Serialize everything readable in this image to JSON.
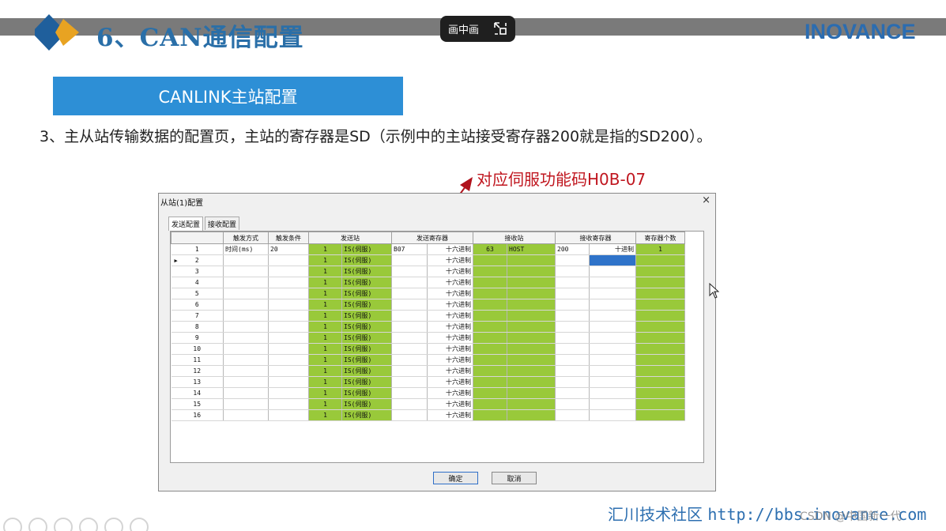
{
  "slide": {
    "title": "6、CAN通信配置",
    "brand": "INOVANCE",
    "pip_label": "画中画",
    "section_label": "CANLINK主站配置",
    "description": "3、主从站传输数据的配置页，主站的寄存器是SD（示例中的主站接受寄存器200就是指的SD200）。",
    "annotation": "对应伺服功能码H0B-07",
    "footer_cn": "汇川技术社区",
    "footer_url": "http://bbs.inovance.com",
    "watermark": "CSDN @中国新一代"
  },
  "dialog": {
    "title": "从站(1)配置",
    "close_glyph": "×",
    "tabs": [
      "发送配置",
      "接收配置"
    ],
    "columns": [
      "触发方式",
      "触发条件",
      "发送站",
      "发送寄存器",
      "接收站",
      "接收寄存器",
      "寄存器个数"
    ],
    "rows": [
      {
        "no": "1",
        "trigger": "时间(ms)",
        "cond": "20",
        "send_id": "1",
        "send_type": "IS(伺服)",
        "send_reg": "B07",
        "send_fmt": "十六进制",
        "recv_id": "63",
        "recv_type": "HOST",
        "recv_reg": "200",
        "recv_fmt": "十进制",
        "count": "1"
      },
      {
        "no": "2",
        "trigger": "",
        "cond": "",
        "send_id": "1",
        "send_type": "IS(伺服)",
        "send_reg": "",
        "send_fmt": "十六进制",
        "recv_id": "",
        "recv_type": "",
        "recv_reg": "",
        "recv_fmt": "",
        "count": ""
      },
      {
        "no": "3",
        "trigger": "",
        "cond": "",
        "send_id": "1",
        "send_type": "IS(伺服)",
        "send_reg": "",
        "send_fmt": "十六进制",
        "recv_id": "",
        "recv_type": "",
        "recv_reg": "",
        "recv_fmt": "",
        "count": ""
      },
      {
        "no": "4",
        "trigger": "",
        "cond": "",
        "send_id": "1",
        "send_type": "IS(伺服)",
        "send_reg": "",
        "send_fmt": "十六进制",
        "recv_id": "",
        "recv_type": "",
        "recv_reg": "",
        "recv_fmt": "",
        "count": ""
      },
      {
        "no": "5",
        "trigger": "",
        "cond": "",
        "send_id": "1",
        "send_type": "IS(伺服)",
        "send_reg": "",
        "send_fmt": "十六进制",
        "recv_id": "",
        "recv_type": "",
        "recv_reg": "",
        "recv_fmt": "",
        "count": ""
      },
      {
        "no": "6",
        "trigger": "",
        "cond": "",
        "send_id": "1",
        "send_type": "IS(伺服)",
        "send_reg": "",
        "send_fmt": "十六进制",
        "recv_id": "",
        "recv_type": "",
        "recv_reg": "",
        "recv_fmt": "",
        "count": ""
      },
      {
        "no": "7",
        "trigger": "",
        "cond": "",
        "send_id": "1",
        "send_type": "IS(伺服)",
        "send_reg": "",
        "send_fmt": "十六进制",
        "recv_id": "",
        "recv_type": "",
        "recv_reg": "",
        "recv_fmt": "",
        "count": ""
      },
      {
        "no": "8",
        "trigger": "",
        "cond": "",
        "send_id": "1",
        "send_type": "IS(伺服)",
        "send_reg": "",
        "send_fmt": "十六进制",
        "recv_id": "",
        "recv_type": "",
        "recv_reg": "",
        "recv_fmt": "",
        "count": ""
      },
      {
        "no": "9",
        "trigger": "",
        "cond": "",
        "send_id": "1",
        "send_type": "IS(伺服)",
        "send_reg": "",
        "send_fmt": "十六进制",
        "recv_id": "",
        "recv_type": "",
        "recv_reg": "",
        "recv_fmt": "",
        "count": ""
      },
      {
        "no": "10",
        "trigger": "",
        "cond": "",
        "send_id": "1",
        "send_type": "IS(伺服)",
        "send_reg": "",
        "send_fmt": "十六进制",
        "recv_id": "",
        "recv_type": "",
        "recv_reg": "",
        "recv_fmt": "",
        "count": ""
      },
      {
        "no": "11",
        "trigger": "",
        "cond": "",
        "send_id": "1",
        "send_type": "IS(伺服)",
        "send_reg": "",
        "send_fmt": "十六进制",
        "recv_id": "",
        "recv_type": "",
        "recv_reg": "",
        "recv_fmt": "",
        "count": ""
      },
      {
        "no": "12",
        "trigger": "",
        "cond": "",
        "send_id": "1",
        "send_type": "IS(伺服)",
        "send_reg": "",
        "send_fmt": "十六进制",
        "recv_id": "",
        "recv_type": "",
        "recv_reg": "",
        "recv_fmt": "",
        "count": ""
      },
      {
        "no": "13",
        "trigger": "",
        "cond": "",
        "send_id": "1",
        "send_type": "IS(伺服)",
        "send_reg": "",
        "send_fmt": "十六进制",
        "recv_id": "",
        "recv_type": "",
        "recv_reg": "",
        "recv_fmt": "",
        "count": ""
      },
      {
        "no": "14",
        "trigger": "",
        "cond": "",
        "send_id": "1",
        "send_type": "IS(伺服)",
        "send_reg": "",
        "send_fmt": "十六进制",
        "recv_id": "",
        "recv_type": "",
        "recv_reg": "",
        "recv_fmt": "",
        "count": ""
      },
      {
        "no": "15",
        "trigger": "",
        "cond": "",
        "send_id": "1",
        "send_type": "IS(伺服)",
        "send_reg": "",
        "send_fmt": "十六进制",
        "recv_id": "",
        "recv_type": "",
        "recv_reg": "",
        "recv_fmt": "",
        "count": ""
      },
      {
        "no": "16",
        "trigger": "",
        "cond": "",
        "send_id": "1",
        "send_type": "IS(伺服)",
        "send_reg": "",
        "send_fmt": "十六进制",
        "recv_id": "",
        "recv_type": "",
        "recv_reg": "",
        "recv_fmt": "",
        "count": ""
      }
    ],
    "ok_label": "确定",
    "cancel_label": "取消"
  },
  "colors": {
    "green_cell": "#99c93a",
    "section_blue": "#2d8fd6",
    "annotation_red": "#c0161f",
    "selection_blue": "#2f73c9"
  },
  "icons": {
    "pip": "pip-exit-icon",
    "logo": "diamond-logo-icon",
    "cursor": "mouse-pointer-icon"
  }
}
